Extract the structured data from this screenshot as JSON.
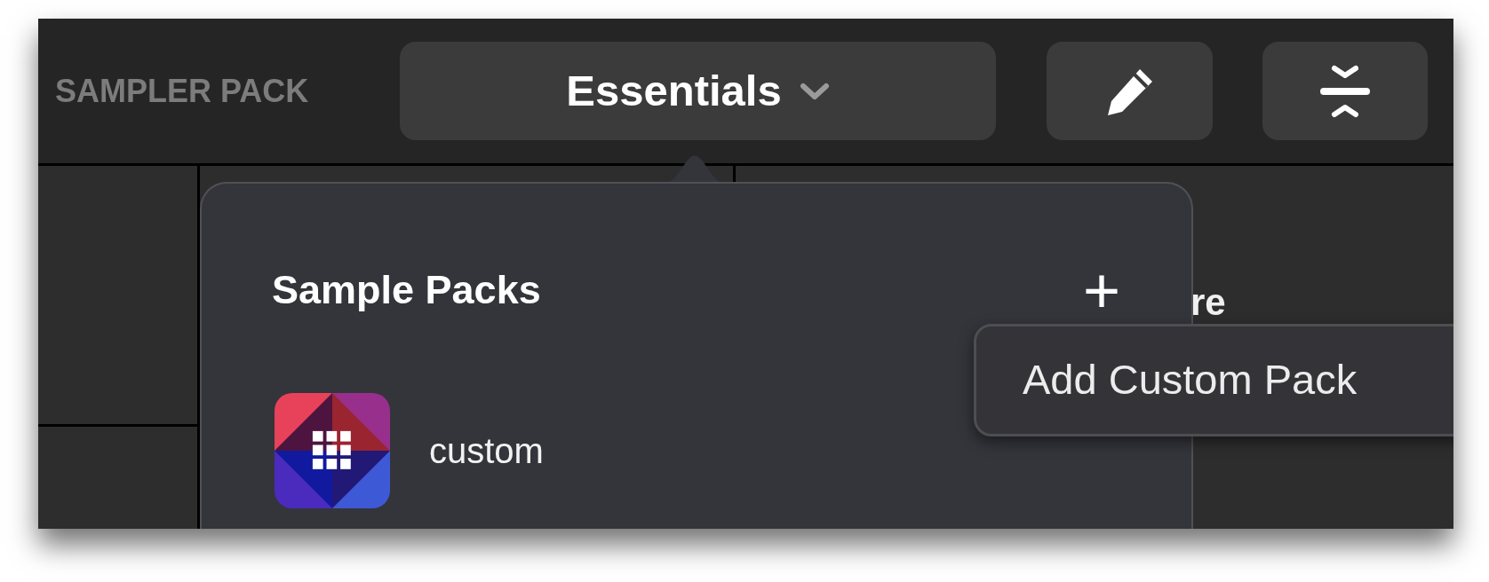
{
  "toolbar": {
    "label": "SAMPLER PACK",
    "pack_selector": {
      "value": "Essentials"
    }
  },
  "background_text": "re",
  "popover": {
    "title": "Sample Packs",
    "add_symbol": "+",
    "items": [
      {
        "name": "custom",
        "kind": "picture"
      }
    ]
  },
  "tooltip": {
    "text": "Add Custom Pack"
  }
}
